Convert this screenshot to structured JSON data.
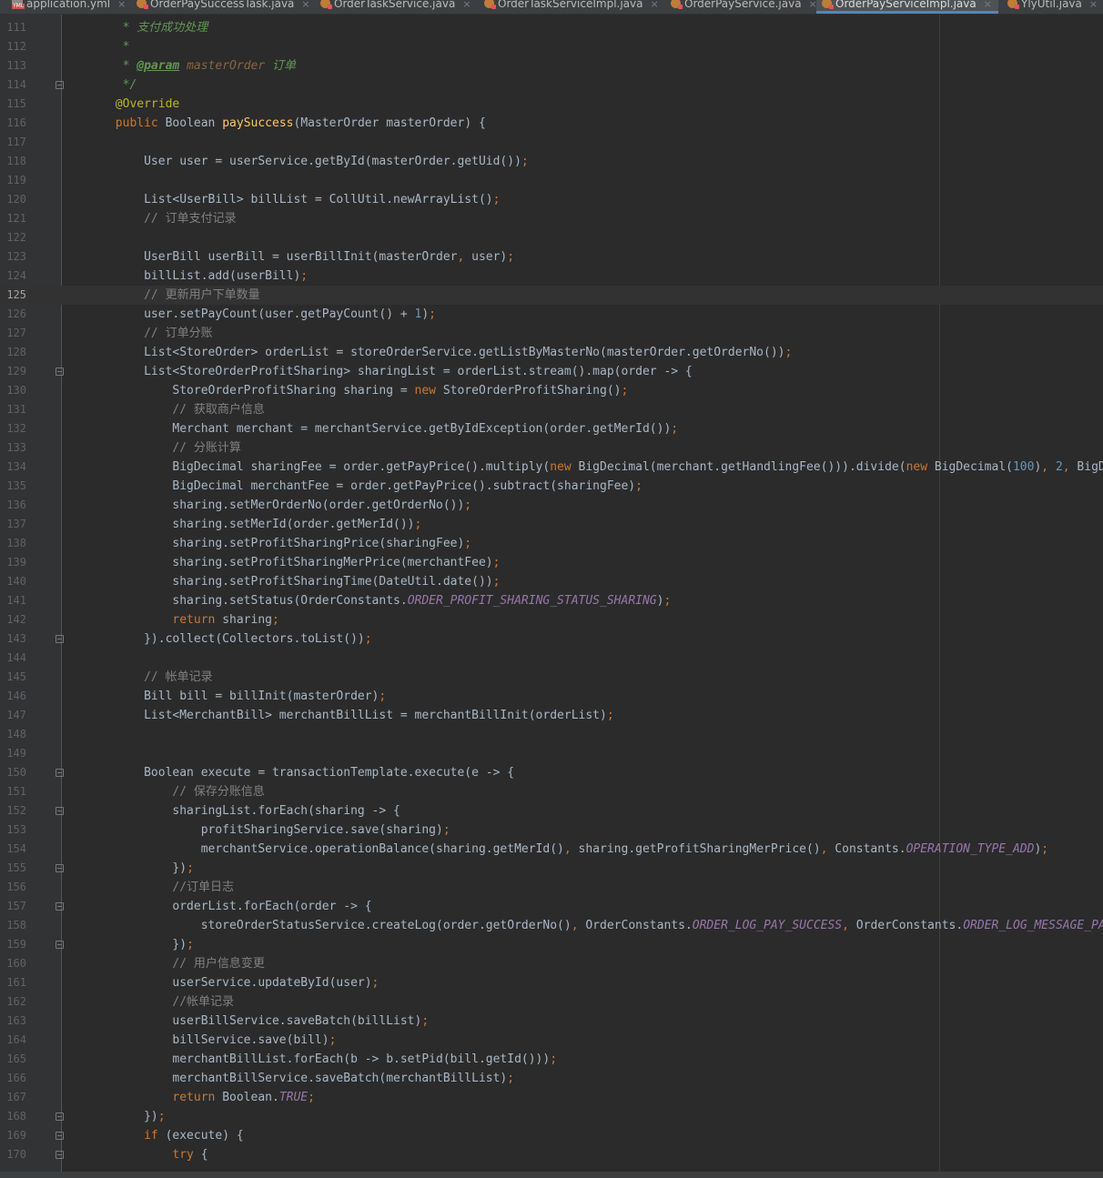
{
  "tabs": [
    {
      "label": "application.yml",
      "icon": "yml-file-icon",
      "active": false
    },
    {
      "label": "OrderPaySuccessTask.java",
      "icon": "java-class-icon",
      "active": false
    },
    {
      "label": "OrderTaskService.java",
      "icon": "java-class-icon",
      "active": false
    },
    {
      "label": "OrderTaskServiceImpl.java",
      "icon": "java-class-icon",
      "active": false
    },
    {
      "label": "OrderPayService.java",
      "icon": "java-class-icon",
      "active": false
    },
    {
      "label": "OrderPayServiceImpl.java",
      "icon": "java-class-icon",
      "active": true
    },
    {
      "label": "YlyUtil.java",
      "icon": "java-class-icon",
      "active": false
    }
  ],
  "close_glyph": "×",
  "editor": {
    "current_line": "125",
    "lines": [
      {
        "n": "111",
        "fold": false,
        "code": "        * 支付成功处理"
      },
      {
        "n": "112",
        "fold": false,
        "code": "        *"
      },
      {
        "n": "113",
        "fold": false,
        "code": "        * @param masterOrder 订单"
      },
      {
        "n": "114",
        "fold": true,
        "code": "        */"
      },
      {
        "n": "115",
        "fold": false,
        "code": "       @Override"
      },
      {
        "n": "116",
        "fold": false,
        "code": "       public Boolean paySuccess(MasterOrder masterOrder) {"
      },
      {
        "n": "117",
        "fold": false,
        "code": ""
      },
      {
        "n": "118",
        "fold": false,
        "code": "           User user = userService.getById(masterOrder.getUid());"
      },
      {
        "n": "119",
        "fold": false,
        "code": ""
      },
      {
        "n": "120",
        "fold": false,
        "code": "           List<UserBill> billList = CollUtil.newArrayList();"
      },
      {
        "n": "121",
        "fold": false,
        "code": "           // 订单支付记录"
      },
      {
        "n": "122",
        "fold": false,
        "code": ""
      },
      {
        "n": "123",
        "fold": false,
        "code": "           UserBill userBill = userBillInit(masterOrder, user);"
      },
      {
        "n": "124",
        "fold": false,
        "code": "           billList.add(userBill);"
      },
      {
        "n": "125",
        "fold": false,
        "code": "           // 更新用户下单数量"
      },
      {
        "n": "126",
        "fold": false,
        "code": "           user.setPayCount(user.getPayCount() + 1);"
      },
      {
        "n": "127",
        "fold": false,
        "code": "           // 订单分账"
      },
      {
        "n": "128",
        "fold": false,
        "code": "           List<StoreOrder> orderList = storeOrderService.getListByMasterNo(masterOrder.getOrderNo());"
      },
      {
        "n": "129",
        "fold": true,
        "code": "           List<StoreOrderProfitSharing> sharingList = orderList.stream().map(order -> {"
      },
      {
        "n": "130",
        "fold": false,
        "code": "               StoreOrderProfitSharing sharing = new StoreOrderProfitSharing();"
      },
      {
        "n": "131",
        "fold": false,
        "code": "               // 获取商户信息"
      },
      {
        "n": "132",
        "fold": false,
        "code": "               Merchant merchant = merchantService.getByIdException(order.getMerId());"
      },
      {
        "n": "133",
        "fold": false,
        "code": "               // 分账计算"
      },
      {
        "n": "134",
        "fold": false,
        "code": "               BigDecimal sharingFee = order.getPayPrice().multiply(new BigDecimal(merchant.getHandlingFee())).divide(new BigDecimal(100), 2, BigD"
      },
      {
        "n": "135",
        "fold": false,
        "code": "               BigDecimal merchantFee = order.getPayPrice().subtract(sharingFee);"
      },
      {
        "n": "136",
        "fold": false,
        "code": "               sharing.setMerOrderNo(order.getOrderNo());"
      },
      {
        "n": "137",
        "fold": false,
        "code": "               sharing.setMerId(order.getMerId());"
      },
      {
        "n": "138",
        "fold": false,
        "code": "               sharing.setProfitSharingPrice(sharingFee);"
      },
      {
        "n": "139",
        "fold": false,
        "code": "               sharing.setProfitSharingMerPrice(merchantFee);"
      },
      {
        "n": "140",
        "fold": false,
        "code": "               sharing.setProfitSharingTime(DateUtil.date());"
      },
      {
        "n": "141",
        "fold": false,
        "code": "               sharing.setStatus(OrderConstants.ORDER_PROFIT_SHARING_STATUS_SHARING);"
      },
      {
        "n": "142",
        "fold": false,
        "code": "               return sharing;"
      },
      {
        "n": "143",
        "fold": true,
        "code": "           }).collect(Collectors.toList());"
      },
      {
        "n": "144",
        "fold": false,
        "code": ""
      },
      {
        "n": "145",
        "fold": false,
        "code": "           // 帐单记录"
      },
      {
        "n": "146",
        "fold": false,
        "code": "           Bill bill = billInit(masterOrder);"
      },
      {
        "n": "147",
        "fold": false,
        "code": "           List<MerchantBill> merchantBillList = merchantBillInit(orderList);"
      },
      {
        "n": "148",
        "fold": false,
        "code": ""
      },
      {
        "n": "149",
        "fold": false,
        "code": ""
      },
      {
        "n": "150",
        "fold": true,
        "code": "           Boolean execute = transactionTemplate.execute(e -> {"
      },
      {
        "n": "151",
        "fold": false,
        "code": "               // 保存分账信息"
      },
      {
        "n": "152",
        "fold": true,
        "code": "               sharingList.forEach(sharing -> {"
      },
      {
        "n": "153",
        "fold": false,
        "code": "                   profitSharingService.save(sharing);"
      },
      {
        "n": "154",
        "fold": false,
        "code": "                   merchantService.operationBalance(sharing.getMerId(), sharing.getProfitSharingMerPrice(), Constants.OPERATION_TYPE_ADD);"
      },
      {
        "n": "155",
        "fold": true,
        "code": "               });"
      },
      {
        "n": "156",
        "fold": false,
        "code": "               //订单日志"
      },
      {
        "n": "157",
        "fold": true,
        "code": "               orderList.forEach(order -> {"
      },
      {
        "n": "158",
        "fold": false,
        "code": "                   storeOrderStatusService.createLog(order.getOrderNo(), OrderConstants.ORDER_LOG_PAY_SUCCESS, OrderConstants.ORDER_LOG_MESSAGE_PA"
      },
      {
        "n": "159",
        "fold": true,
        "code": "               });"
      },
      {
        "n": "160",
        "fold": false,
        "code": "               // 用户信息变更"
      },
      {
        "n": "161",
        "fold": false,
        "code": "               userService.updateById(user);"
      },
      {
        "n": "162",
        "fold": false,
        "code": "               //帐单记录"
      },
      {
        "n": "163",
        "fold": false,
        "code": "               userBillService.saveBatch(billList);"
      },
      {
        "n": "164",
        "fold": false,
        "code": "               billService.save(bill);"
      },
      {
        "n": "165",
        "fold": false,
        "code": "               merchantBillList.forEach(b -> b.setPid(bill.getId()));"
      },
      {
        "n": "166",
        "fold": false,
        "code": "               merchantBillService.saveBatch(merchantBillList);"
      },
      {
        "n": "167",
        "fold": false,
        "code": "               return Boolean.TRUE;"
      },
      {
        "n": "168",
        "fold": true,
        "code": "           });"
      },
      {
        "n": "169",
        "fold": true,
        "code": "           if (execute) {"
      },
      {
        "n": "170",
        "fold": true,
        "code": "               try {"
      }
    ]
  }
}
